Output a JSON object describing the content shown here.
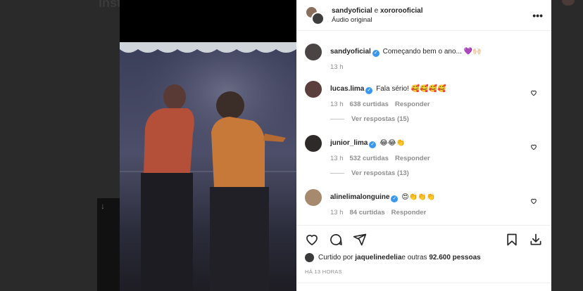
{
  "background": {
    "logo_fragment": "Inst"
  },
  "header": {
    "user1": "sandyoficial",
    "connector": " e ",
    "user2": "xororooficial",
    "audio": "Áudio original"
  },
  "caption": {
    "user": "sandyoficial",
    "text": "Começando bem o ano... 💜🙌🏻",
    "time": "13 h"
  },
  "comments": [
    {
      "user": "lucas.lima",
      "text": "Fala sério! 🥰🥰🥰🥰",
      "time": "13 h",
      "likes": "638 curtidas",
      "reply": "Responder",
      "replies": "Ver respostas (15)"
    },
    {
      "user": "junior_lima",
      "text": "😂😂👏",
      "time": "13 h",
      "likes": "532 curtidas",
      "reply": "Responder",
      "replies": "Ver respostas (13)"
    },
    {
      "user": "alinelimalonguine",
      "text": "😍👏👏👏",
      "time": "13 h",
      "likes": "84 curtidas",
      "reply": "Responder"
    }
  ],
  "likes": {
    "prefix": "Curtido por ",
    "user": "jaquelinedelia",
    "suffix": " e outras ",
    "count": "92.600 pessoas"
  },
  "time_ago": "HÁ 13 HORAS",
  "colors": {
    "verified": "#3897f0",
    "muted": "#8e8e8e",
    "text": "#262626"
  }
}
